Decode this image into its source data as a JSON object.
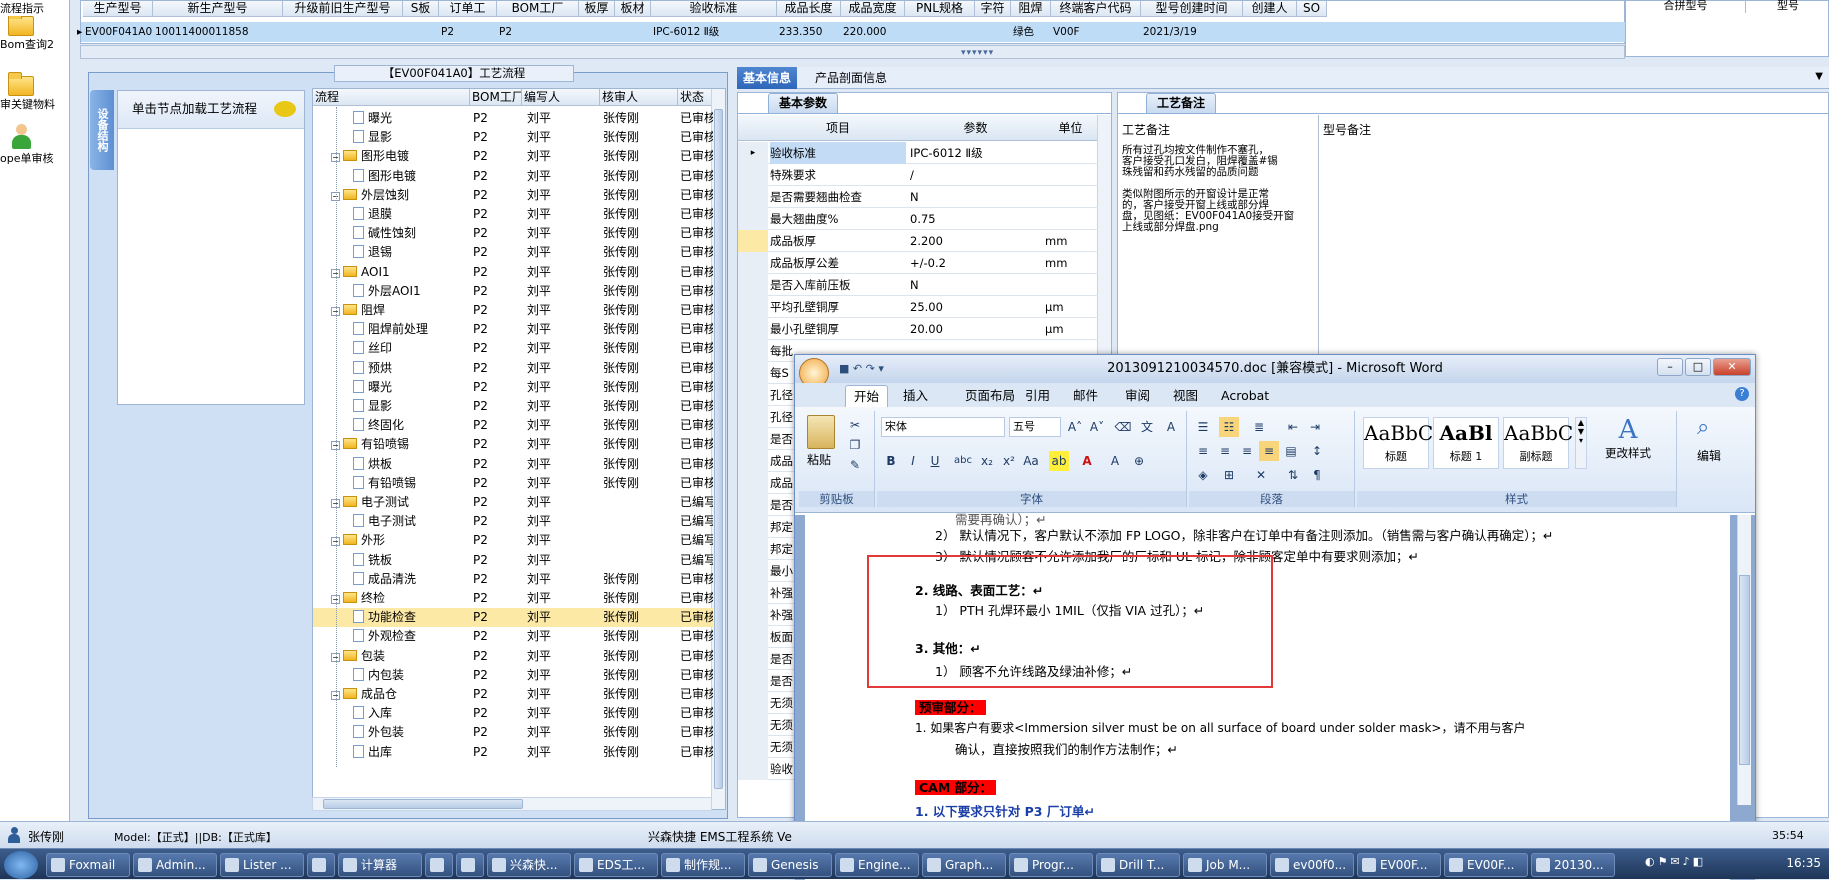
{
  "left_nav": [
    {
      "label": "流程指示",
      "icon": "folder-icon"
    },
    {
      "label": "Bom查询2",
      "icon": "folder-icon"
    },
    {
      "label": "审关键物料",
      "icon": "folder-icon"
    },
    {
      "label": "ope单审核",
      "icon": "user-icon"
    }
  ],
  "top_table": {
    "headers": [
      "生产型号",
      "新生产型号",
      "升级前旧生产型号",
      "S板",
      "订单工",
      "BOM工厂",
      "板厚",
      "板材",
      "验收标准",
      "成品长度",
      "成品宽度",
      "PNL规格",
      "字符",
      "阻焊",
      "终端客户代码",
      "型号创建时间",
      "创建人",
      "SO"
    ],
    "row": [
      "EV00F041A0",
      "10011400011858",
      "",
      "",
      "P2",
      "P2",
      "",
      "",
      "IPC-6012 Ⅱ级",
      "233.350",
      "220.000",
      "",
      "",
      "绿色",
      "V00F",
      "2021/3/19",
      "",
      ""
    ]
  },
  "top_right": {
    "col1": "合拼型号",
    "col2": "型号"
  },
  "process_panel": {
    "title": "【EV00F041A0】工艺流程",
    "side_tab": "设备结构",
    "load_hint": "单击节点加载工艺流程",
    "columns": [
      "流程",
      "BOM工厂",
      "编写人",
      "核审人",
      "状态"
    ],
    "rows": [
      {
        "indent": 2,
        "type": "doc",
        "name": "曝光",
        "bom": "P2",
        "writer": "刘平",
        "reviewer": "张传刚",
        "status": "已审核"
      },
      {
        "indent": 2,
        "type": "doc",
        "name": "显影",
        "bom": "P2",
        "writer": "刘平",
        "reviewer": "张传刚",
        "status": "已审核"
      },
      {
        "indent": 1,
        "type": "folder",
        "name": "图形电镀",
        "bom": "P2",
        "writer": "刘平",
        "reviewer": "张传刚",
        "status": "已审核"
      },
      {
        "indent": 2,
        "type": "doc",
        "name": "图形电镀",
        "bom": "P2",
        "writer": "刘平",
        "reviewer": "张传刚",
        "status": "已审核"
      },
      {
        "indent": 1,
        "type": "folder",
        "name": "外层蚀刻",
        "bom": "P2",
        "writer": "刘平",
        "reviewer": "张传刚",
        "status": "已审核"
      },
      {
        "indent": 2,
        "type": "doc",
        "name": "退膜",
        "bom": "P2",
        "writer": "刘平",
        "reviewer": "张传刚",
        "status": "已审核"
      },
      {
        "indent": 2,
        "type": "doc",
        "name": "碱性蚀刻",
        "bom": "P2",
        "writer": "刘平",
        "reviewer": "张传刚",
        "status": "已审核"
      },
      {
        "indent": 2,
        "type": "doc",
        "name": "退锡",
        "bom": "P2",
        "writer": "刘平",
        "reviewer": "张传刚",
        "status": "已审核"
      },
      {
        "indent": 1,
        "type": "folder",
        "name": "AOI1",
        "bom": "P2",
        "writer": "刘平",
        "reviewer": "张传刚",
        "status": "已审核"
      },
      {
        "indent": 2,
        "type": "doc",
        "name": "外层AOI1",
        "bom": "P2",
        "writer": "刘平",
        "reviewer": "张传刚",
        "status": "已审核"
      },
      {
        "indent": 1,
        "type": "folder",
        "name": "阻焊",
        "bom": "P2",
        "writer": "刘平",
        "reviewer": "张传刚",
        "status": "已审核"
      },
      {
        "indent": 2,
        "type": "doc",
        "name": "阻焊前处理",
        "bom": "P2",
        "writer": "刘平",
        "reviewer": "张传刚",
        "status": "已审核"
      },
      {
        "indent": 2,
        "type": "doc",
        "name": "丝印",
        "bom": "P2",
        "writer": "刘平",
        "reviewer": "张传刚",
        "status": "已审核"
      },
      {
        "indent": 2,
        "type": "doc",
        "name": "预烘",
        "bom": "P2",
        "writer": "刘平",
        "reviewer": "张传刚",
        "status": "已审核"
      },
      {
        "indent": 2,
        "type": "doc",
        "name": "曝光",
        "bom": "P2",
        "writer": "刘平",
        "reviewer": "张传刚",
        "status": "已审核"
      },
      {
        "indent": 2,
        "type": "doc",
        "name": "显影",
        "bom": "P2",
        "writer": "刘平",
        "reviewer": "张传刚",
        "status": "已审核"
      },
      {
        "indent": 2,
        "type": "doc",
        "name": "终固化",
        "bom": "P2",
        "writer": "刘平",
        "reviewer": "张传刚",
        "status": "已审核"
      },
      {
        "indent": 1,
        "type": "folder",
        "name": "有铅喷锡",
        "bom": "P2",
        "writer": "刘平",
        "reviewer": "张传刚",
        "status": "已审核"
      },
      {
        "indent": 2,
        "type": "doc",
        "name": "烘板",
        "bom": "P2",
        "writer": "刘平",
        "reviewer": "张传刚",
        "status": "已审核"
      },
      {
        "indent": 2,
        "type": "doc",
        "name": "有铅喷锡",
        "bom": "P2",
        "writer": "刘平",
        "reviewer": "张传刚",
        "status": "已审核"
      },
      {
        "indent": 1,
        "type": "folder",
        "name": "电子测试",
        "bom": "P2",
        "writer": "刘平",
        "reviewer": "",
        "status": "已编写"
      },
      {
        "indent": 2,
        "type": "doc",
        "name": "电子测试",
        "bom": "P2",
        "writer": "刘平",
        "reviewer": "",
        "status": "已编写"
      },
      {
        "indent": 1,
        "type": "folder",
        "name": "外形",
        "bom": "P2",
        "writer": "刘平",
        "reviewer": "",
        "status": "已编写"
      },
      {
        "indent": 2,
        "type": "doc",
        "name": "铣板",
        "bom": "P2",
        "writer": "刘平",
        "reviewer": "",
        "status": "已编写"
      },
      {
        "indent": 2,
        "type": "doc",
        "name": "成品清洗",
        "bom": "P2",
        "writer": "刘平",
        "reviewer": "张传刚",
        "status": "已审核"
      },
      {
        "indent": 1,
        "type": "folder",
        "name": "终检",
        "bom": "P2",
        "writer": "刘平",
        "reviewer": "张传刚",
        "status": "已审核"
      },
      {
        "indent": 2,
        "type": "doc",
        "name": "功能检查",
        "bom": "P2",
        "writer": "刘平",
        "reviewer": "张传刚",
        "status": "已审核",
        "selected": true
      },
      {
        "indent": 2,
        "type": "doc",
        "name": "外观检查",
        "bom": "P2",
        "writer": "刘平",
        "reviewer": "张传刚",
        "status": "已审核"
      },
      {
        "indent": 1,
        "type": "folder",
        "name": "包装",
        "bom": "P2",
        "writer": "刘平",
        "reviewer": "张传刚",
        "status": "已审核"
      },
      {
        "indent": 2,
        "type": "doc",
        "name": "内包装",
        "bom": "P2",
        "writer": "刘平",
        "reviewer": "张传刚",
        "status": "已审核"
      },
      {
        "indent": 1,
        "type": "folder",
        "name": "成品仓",
        "bom": "P2",
        "writer": "刘平",
        "reviewer": "张传刚",
        "status": "已审核"
      },
      {
        "indent": 2,
        "type": "doc",
        "name": "入库",
        "bom": "P2",
        "writer": "刘平",
        "reviewer": "张传刚",
        "status": "已审核"
      },
      {
        "indent": 2,
        "type": "doc",
        "name": "外包装",
        "bom": "P2",
        "writer": "刘平",
        "reviewer": "张传刚",
        "status": "已审核"
      },
      {
        "indent": 2,
        "type": "doc",
        "name": "出库",
        "bom": "P2",
        "writer": "刘平",
        "reviewer": "张传刚",
        "status": "已审核"
      }
    ]
  },
  "right_tabs": [
    "基本信息",
    "产品剖面信息"
  ],
  "basic_params": {
    "section_title": "基本参数",
    "columns": [
      "项目",
      "参数",
      "单位"
    ],
    "rows": [
      {
        "item": "验收标准",
        "value": "IPC-6012 Ⅱ级",
        "unit": "",
        "current": true
      },
      {
        "item": "特殊要求",
        "value": "/",
        "unit": ""
      },
      {
        "item": "是否需要翘曲检查",
        "value": "N",
        "unit": ""
      },
      {
        "item": "最大翘曲度%",
        "value": "0.75",
        "unit": ""
      },
      {
        "item": "成品板厚",
        "value": "2.200",
        "unit": "mm",
        "highlight": true
      },
      {
        "item": "成品板厚公差",
        "value": "+/-0.2",
        "unit": "mm"
      },
      {
        "item": "是否入库前压板",
        "value": "N",
        "unit": ""
      },
      {
        "item": "平均孔壁铜厚",
        "value": "25.00",
        "unit": "μm"
      },
      {
        "item": "最小孔壁铜厚",
        "value": "20.00",
        "unit": "μm"
      }
    ],
    "truncated_items": [
      "每批",
      "每S",
      "孔径",
      "孔径",
      "是否",
      "成品",
      "成品",
      "是否",
      "邦定",
      "邦定",
      "最小",
      "补强",
      "补强",
      "板面",
      "是否",
      "是否",
      "无须",
      "无须",
      "无须",
      "验收"
    ]
  },
  "notes": {
    "tab": "工艺备注",
    "col1": "工艺备注",
    "col2": "型号备注",
    "lines": [
      "所有过孔均按文件制作不塞孔，",
      "客户接受孔口发白，阻焊覆盖#锡",
      "珠残留和药水残留的品质问题",
      "",
      "类似附图所示的开窗设计是正常",
      "的，客户接受开窗上线或部分焊",
      "盘，见图纸：EV00F041A0接受开窗",
      "上线或部分焊盘.png"
    ]
  },
  "word": {
    "title": "2013091210034570.doc [兼容模式] - Microsoft Word",
    "tabs": [
      "开始",
      "插入",
      "页面布局",
      "引用",
      "邮件",
      "审阅",
      "视图",
      "Acrobat"
    ],
    "font_name": "宋体",
    "font_size": "五号",
    "groups": {
      "clipboard": "剪贴板",
      "font": "字体",
      "paragraph": "段落",
      "styles": "样式"
    },
    "paste": "粘贴",
    "styles": [
      {
        "preview": "AaBbC",
        "name": "标题"
      },
      {
        "preview": "AaBl",
        "name": "标题 1"
      },
      {
        "preview": "AaBbC",
        "name": "副标题"
      }
    ],
    "change_styles": "更改样式",
    "edit": "编辑",
    "doc_lines": {
      "l0": "需要再确认）；↵",
      "l1": "2） 默认情况下，客户默认不添加 FP LOGO，除非客户在订单中有备注则添加。（销售需与客户确认再确定）；↵",
      "l2": "3） 默认情况顾客不允许添加我厂的厂标和 UL 标记，除非顾客定单中有要求则添加；↵",
      "l3": "2.  线路、表面工艺：↵",
      "l4": "1） PTH 孔焊环最小 1MIL（仅指 VIA 过孔）；↵",
      "l5": "3.  其他：↵",
      "l6": "1） 顾客不允许线路及绿油补修；↵",
      "l7": "预审部分：",
      "l8": "1.   如果客户有要求<Immersion silver must be on all surface of board under solder mask>，请不用与客户",
      "l9": "确认，直接按照我们的制作方法制作；↵",
      "l10": "CAM 部分：",
      "l11": "1. 以下要求只针对 P3 厂订单↵"
    }
  },
  "statusbar": {
    "user": "张传刚",
    "model": "Model:【正式】||DB:【正式库】",
    "company": "兴森快捷 EMS工程系统 Ve",
    "time_partial": "35:54"
  },
  "taskbar": {
    "items": [
      "Foxmail",
      "Admin...",
      "Lister ...",
      "",
      "计算器",
      "",
      "",
      "兴森快...",
      "EDS工...",
      "制作规...",
      "Genesis",
      "Engine...",
      "Graph...",
      "Progr...",
      "Drill T...",
      "Job M...",
      "ev00f0...",
      "EV00F...",
      "EV00F...",
      "20130..."
    ],
    "clock": "16:35"
  }
}
